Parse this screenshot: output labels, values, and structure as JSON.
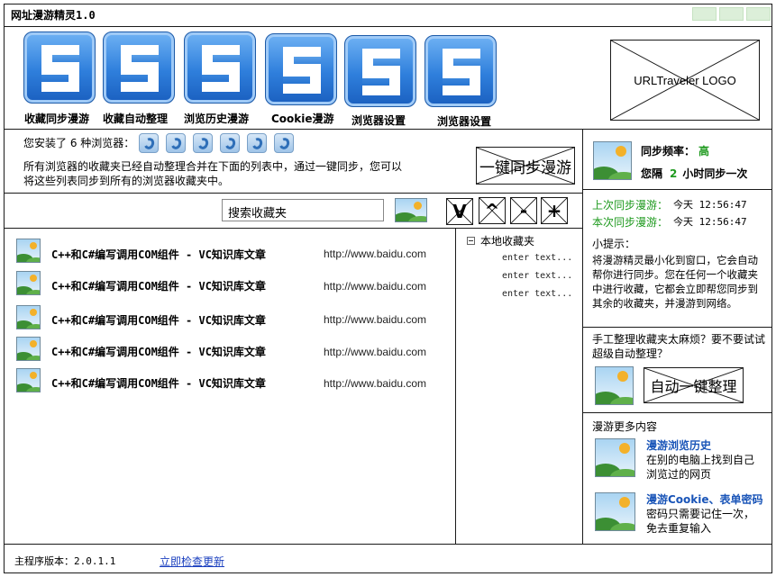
{
  "window": {
    "title": "网址漫游精灵1.0"
  },
  "toolbar": [
    {
      "label": "收藏同步漫游"
    },
    {
      "label": "收藏自动整理"
    },
    {
      "label": "浏览历史漫游"
    },
    {
      "label": "Cookie漫游"
    },
    {
      "label": "浏览器设置"
    },
    {
      "label": "浏览器设置"
    }
  ],
  "logo": {
    "text": "URLTraveler LOGO"
  },
  "browsers": {
    "prefix": "您安装了 6 种浏览器：",
    "count": 6,
    "description": "所有浏览器的收藏夹已经自动整理合并在下面的列表中，通过一键同步，您可以将这些列表同步到所有的浏览器收藏夹中。"
  },
  "sync_button": {
    "label": "一键同步漫游"
  },
  "search": {
    "placeholder": "搜索收藏夹"
  },
  "tool_buttons": {
    "down": "V",
    "up": "^",
    "remove": "-",
    "add": "+"
  },
  "favorites": [
    {
      "title": "C++和C#编写调用COM组件 - VC知识库文章",
      "url": "http://www.baidu.com"
    },
    {
      "title": "C++和C#编写调用COM组件 - VC知识库文章",
      "url": "http://www.baidu.com"
    },
    {
      "title": "C++和C#编写调用COM组件 - VC知识库文章",
      "url": "http://www.baidu.com"
    },
    {
      "title": "C++和C#编写调用COM组件 - VC知识库文章",
      "url": "http://www.baidu.com"
    },
    {
      "title": "C++和C#编写调用COM组件 - VC知识库文章",
      "url": "http://www.baidu.com"
    }
  ],
  "tree": {
    "root": "本地收藏夹",
    "items": [
      "enter text...",
      "enter text...",
      "enter text..."
    ]
  },
  "sync_panel": {
    "freq_label": "同步频率：",
    "freq_value": "高",
    "interval_prefix": "您隔",
    "interval_value": "2",
    "interval_suffix": "小时同步一次",
    "last_label": "上次同步漫游：",
    "last_value": "今天 12:56:47",
    "current_label": "本次同步漫游：",
    "current_value": "今天 12:56:47"
  },
  "tip": {
    "title": "小提示：",
    "text": "将漫游精灵最小化到窗口，它会自动帮你进行同步。您在任何一个收藏夹中进行收藏，它都会立即帮您同步到其余的收藏夹，并漫游到网络。"
  },
  "auto_organize": {
    "question": "手工整理收藏夹太麻烦？要不要试试超级自动整理？",
    "button": "自动一键整理"
  },
  "more": {
    "title": "漫游更多内容",
    "items": [
      {
        "heading": "漫游浏览历史",
        "desc": "在别的电脑上找到自己浏览过的网页"
      },
      {
        "heading": "漫游Cookie、表单密码",
        "desc": "密码只需要记住一次，免去重复输入"
      }
    ]
  },
  "footer": {
    "version": "主程序版本：2.0.1.1",
    "update_link": "立即检查更新"
  }
}
